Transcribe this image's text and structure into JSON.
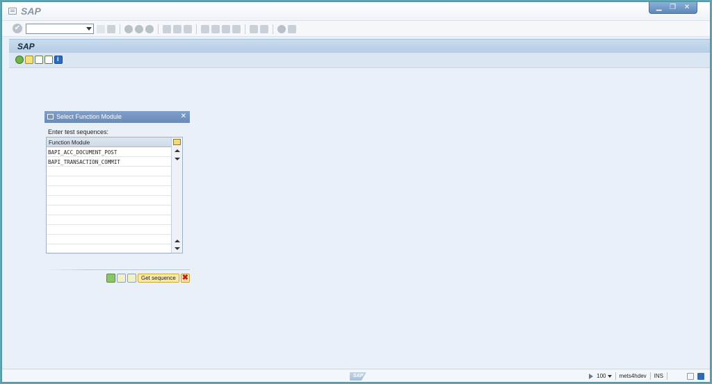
{
  "window": {
    "title": "SAP",
    "controls": [
      "minimize",
      "restore",
      "close"
    ]
  },
  "toolbar": {
    "command_value": ""
  },
  "screen": {
    "title": "SAP"
  },
  "app_toolbar": {
    "icons": [
      "execute-icon",
      "copy-icon",
      "variant-icon",
      "table-icon",
      "info-icon"
    ]
  },
  "dialog": {
    "title": "Select Function Module",
    "label": "Enter test sequences:",
    "column_header": "Function Module",
    "rows": [
      "BAPI_ACC_DOCUMENT_POST",
      "BAPI_TRANSACTION_COMMIT",
      "",
      "",
      "",
      "",
      "",
      "",
      "",
      "",
      ""
    ],
    "get_sequence_label": "Get sequence"
  },
  "status": {
    "zoom": "100",
    "system": "mets4hdev",
    "mode": "INS",
    "logo": "SAP"
  },
  "colors": {
    "header": "#b5cde6",
    "dialog_title": "#6a8bb8",
    "background": "#eaf0f8"
  }
}
